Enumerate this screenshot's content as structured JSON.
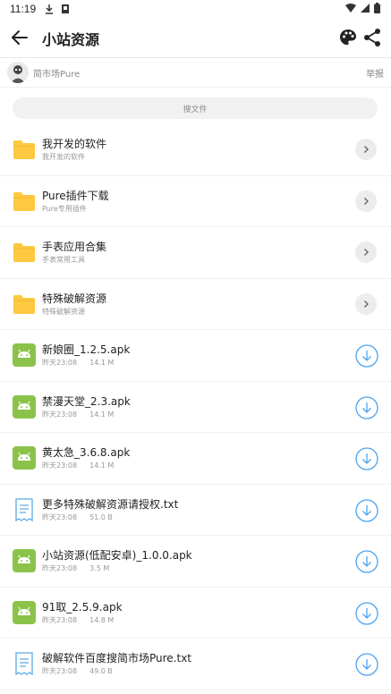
{
  "status_bar": {
    "time": "11:19"
  },
  "header": {
    "title": "小站资源"
  },
  "owner": {
    "name": "简市场Pure",
    "report_label": "举报"
  },
  "search": {
    "placeholder": "搜文件"
  },
  "folders": [
    {
      "name": "我开发的软件",
      "desc": "我开发的软件"
    },
    {
      "name": "Pure插件下载",
      "desc": "Pure专用插件"
    },
    {
      "name": "手表应用合集",
      "desc": "手表常用工具"
    },
    {
      "name": "特殊破解资源",
      "desc": "特殊破解资源"
    }
  ],
  "files": [
    {
      "name": "新娘圈_1.2.5.apk",
      "date": "昨天23:08",
      "size": "14.1 M",
      "type": "apk"
    },
    {
      "name": "禁漫天堂_2.3.apk",
      "date": "昨天23:08",
      "size": "14.1 M",
      "type": "apk"
    },
    {
      "name": "黄太急_3.6.8.apk",
      "date": "昨天23:08",
      "size": "14.1 M",
      "type": "apk"
    },
    {
      "name": "更多特殊破解资源请授权.txt",
      "date": "昨天23:08",
      "size": "51.0 B",
      "type": "txt"
    },
    {
      "name": "小站资源(低配安卓)_1.0.0.apk",
      "date": "昨天23:08",
      "size": "3.5 M",
      "type": "apk"
    },
    {
      "name": "91取_2.5.9.apk",
      "date": "昨天23:08",
      "size": "14.8 M",
      "type": "apk"
    },
    {
      "name": "破解软件百度搜简市场Pure.txt",
      "date": "昨天23:08",
      "size": "49.0 B",
      "type": "txt"
    }
  ],
  "colors": {
    "folder": "#fcc940",
    "apk": "#8bc34a",
    "txt": "#5aa9e6",
    "download": "#4da3f0"
  }
}
